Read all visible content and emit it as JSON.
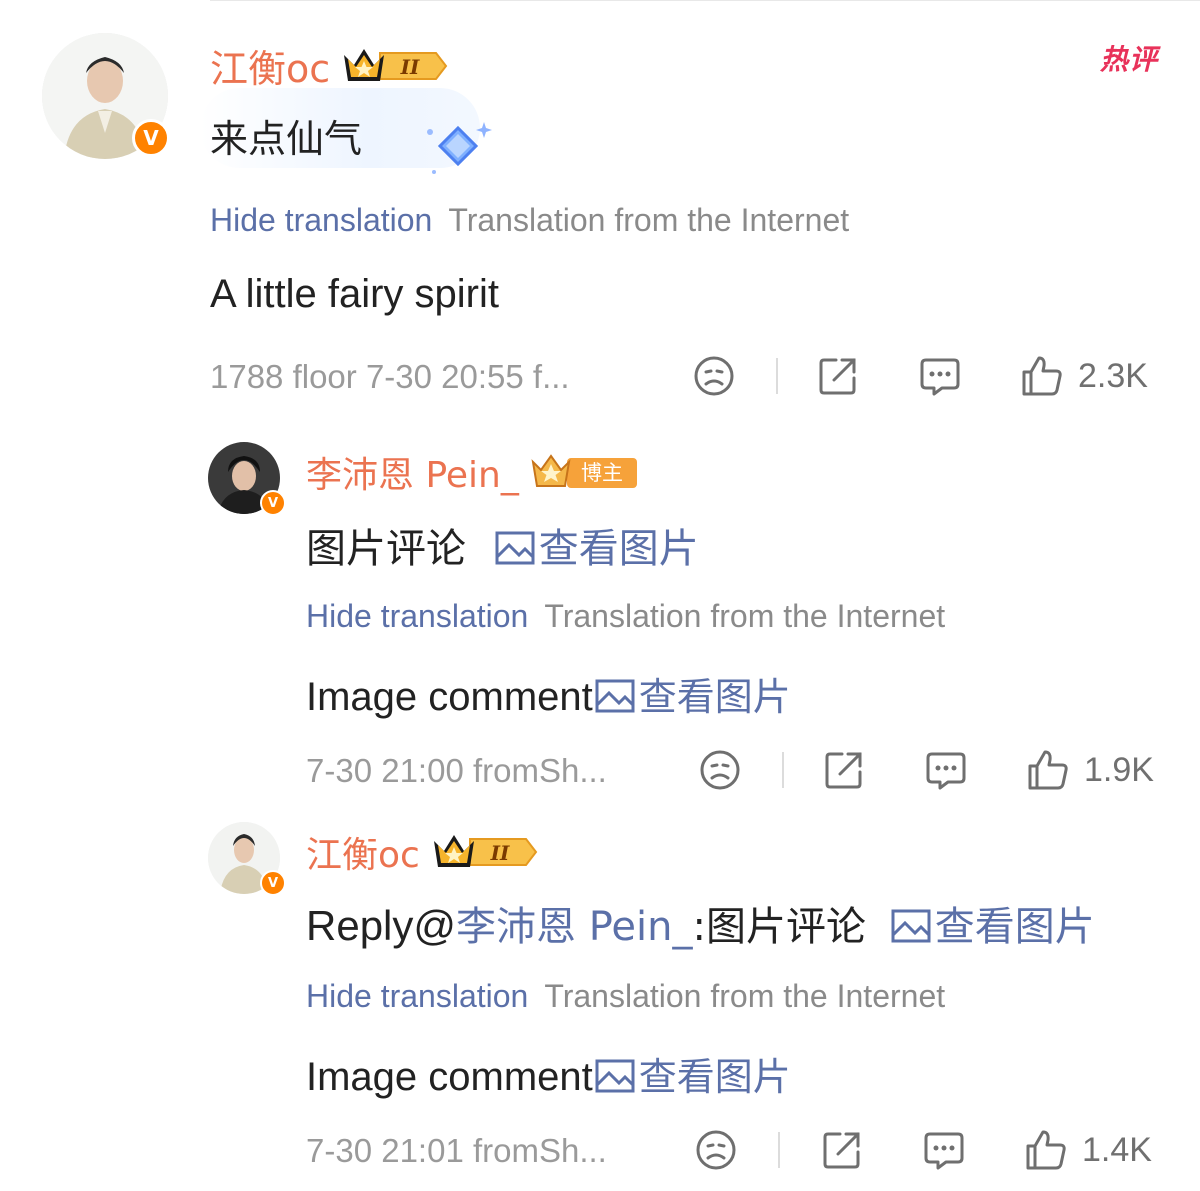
{
  "hot_tag": "热评",
  "comments": [
    {
      "username": "江衡oc",
      "badge": "II",
      "body": "来点仙气",
      "hide_translation": "Hide translation",
      "translation_source": "Translation from the Internet",
      "translation": "A little fairy spirit",
      "meta": "1788 floor 7-30 20:55 f...",
      "likes": "2.3K"
    },
    {
      "username": "李沛恩 Pein_",
      "badge": "博主",
      "body_prefix": "图片评论",
      "body_link": "查看图片",
      "hide_translation": "Hide translation",
      "translation_source": "Translation from the Internet",
      "translation_prefix": "Image comment",
      "translation_link": "查看图片",
      "meta": "7-30 21:00 fromSh...",
      "likes": "1.9K"
    },
    {
      "username": "江衡oc",
      "badge": "II",
      "body_reply": "Reply@",
      "body_mention": "李沛恩 Pein_",
      "body_prefix": ":图片评论",
      "body_link": "查看图片",
      "hide_translation": "Hide translation",
      "translation_source": "Translation from the Internet",
      "translation_prefix": "Image comment",
      "translation_link": "查看图片",
      "meta": "7-30 21:01 fromSh...",
      "likes": "1.4K"
    }
  ],
  "colors": {
    "username": "#eb7350",
    "link": "#5b70a8",
    "hot": "#e8325a",
    "verified": "#ff8200"
  },
  "icons": [
    "dislike-face-icon",
    "share-icon",
    "comment-icon",
    "thumbs-up-icon",
    "picture-icon",
    "crown-icon",
    "verified-icon"
  ]
}
